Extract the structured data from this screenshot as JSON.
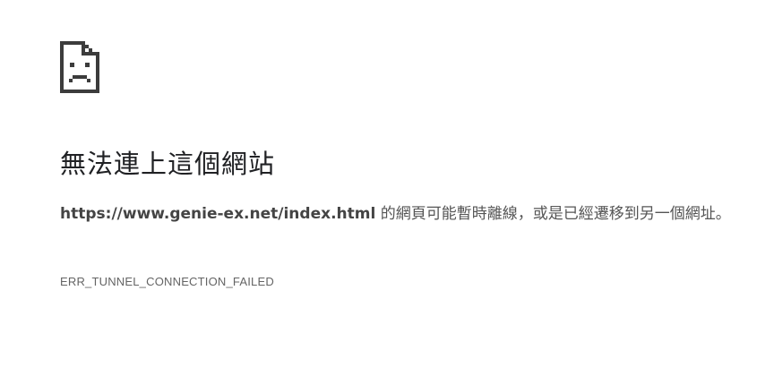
{
  "error_page": {
    "icon": "sad-page-icon",
    "title": "無法連上這個網站",
    "message_url": "https://www.genie-ex.net/index.html",
    "message_text": " 的網頁可能暫時離線，或是已經遷移到另一個網址。",
    "error_code": "ERR_TUNNEL_CONNECTION_FAILED"
  }
}
